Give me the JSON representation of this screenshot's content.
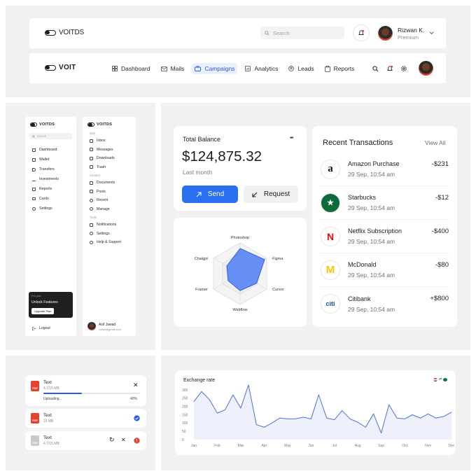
{
  "header1": {
    "logo": "VOITDS",
    "search_placeholder": "Search",
    "user_name": "Rizwan K.",
    "user_plan": "Premium",
    "bell_icon": "bell-icon",
    "chevron_icon": "chevron-down-icon"
  },
  "header2": {
    "logo": "VOIT",
    "nav": [
      {
        "label": "Dashboard",
        "icon": "grid-icon"
      },
      {
        "label": "Mails",
        "icon": "mail-icon"
      },
      {
        "label": "Campaigns",
        "icon": "briefcase-icon",
        "active": true
      },
      {
        "label": "Analytics",
        "icon": "chart-icon"
      },
      {
        "label": "Leads",
        "icon": "user-circle-icon"
      },
      {
        "label": "Reports",
        "icon": "clipboard-icon"
      }
    ]
  },
  "sidebar1": {
    "logo": "VOITDS",
    "search_placeholder": "Search",
    "items": [
      "Dashboard",
      "Wallet",
      "Transfers",
      "Investments",
      "Reports",
      "Cards",
      "Settings"
    ],
    "promo_small": "Pro plan",
    "promo_title": "Unlock Features",
    "promo_button": "Upgrade Plan",
    "logout": "Logout"
  },
  "sidebar2": {
    "logo": "VOITDS",
    "section_mail": "Mail",
    "mail_items": [
      "Inbox",
      "Messages",
      "Downloads",
      "Trash"
    ],
    "section_content": "Content",
    "content_items": [
      "Documents",
      "Posts",
      "Recent",
      "Manage"
    ],
    "section_tools": "Tools",
    "tools_items": [
      "Notifications",
      "Settings",
      "Help & Support"
    ],
    "user_name": "Asif Jawad",
    "user_email": "voitds@gmail.com"
  },
  "balance": {
    "title": "Total Balance",
    "more": "•••",
    "amount": "$124,875.32",
    "period": "Last month",
    "send_label": "Send",
    "request_label": "Request"
  },
  "radar": {
    "labels": [
      "Photoshop",
      "Figma",
      "Cursor",
      "Webflow",
      "Framer",
      "Chatgpt"
    ],
    "values": [
      0.82,
      0.92,
      0.62,
      0.55,
      0.45,
      0.5
    ],
    "color": "#4f7cf5"
  },
  "transactions": {
    "title": "Recent Transactions",
    "view_all": "View All",
    "items": [
      {
        "name": "Amazon Purchase",
        "date": "29 Sep, 10:54 am",
        "amount": "-$231",
        "logo": "a",
        "logo_color": "#111111"
      },
      {
        "name": "Starbucks",
        "date": "29 Sep, 10:54 am",
        "amount": "-$12",
        "logo": "★",
        "logo_color": "#0b6b3a"
      },
      {
        "name": "Netflix Subscription",
        "date": "29 Sep, 10:54 am",
        "amount": "-$400",
        "logo": "N",
        "logo_color": "#e50914"
      },
      {
        "name": "McDonald",
        "date": "29 Sep, 10:54 am",
        "amount": "-$80",
        "logo": "M",
        "logo_color": "#ffc300"
      },
      {
        "name": "Citibank",
        "date": "29 Sep, 10:54 am",
        "amount": "+$800",
        "logo": "citi",
        "logo_color": "#0b56a4"
      }
    ]
  },
  "files": [
    {
      "name": "Text",
      "size": "4.7/15 MB",
      "status": "Uploading...",
      "progress_pct": "40%",
      "progress": 0.4,
      "badge": "PDF",
      "badge_color": "#e8412c"
    },
    {
      "name": "Text",
      "size": "15 MB",
      "badge": "PDF",
      "badge_color": "#e8412c"
    },
    {
      "name": "Text",
      "size": "4.7/15 MB",
      "badge": "PDF",
      "badge_color": "#c9c9c9"
    }
  ],
  "chart_data": {
    "type": "area",
    "title": "Exchange rate",
    "categories": [
      "Jan",
      "Feb",
      "Mar",
      "Apr",
      "May",
      "Jun",
      "Jul",
      "Aug",
      "Sep",
      "Oct",
      "Nov",
      "Dec"
    ],
    "x": [
      0,
      0.33,
      0.67,
      1,
      1.33,
      1.67,
      2,
      2.33,
      2.67,
      3,
      3.33,
      3.67,
      4,
      4.33,
      4.67,
      5,
      5.33,
      5.67,
      6,
      6.33,
      6.67,
      7,
      7.33,
      7.67,
      8,
      8.33,
      8.67,
      9,
      9.33,
      9.67,
      10,
      10.33,
      10.67,
      11
    ],
    "values": [
      230,
      290,
      240,
      160,
      180,
      270,
      190,
      330,
      90,
      75,
      100,
      130,
      125,
      125,
      135,
      125,
      270,
      130,
      120,
      175,
      125,
      105,
      75,
      155,
      40,
      210,
      130,
      125,
      150,
      130,
      155,
      130,
      140,
      165
    ],
    "ylim": [
      0,
      300
    ],
    "yticks": [
      0,
      50,
      100,
      150,
      200,
      250,
      300
    ],
    "line_color": "#4a72d6",
    "fill_color": "#eef1fc"
  }
}
